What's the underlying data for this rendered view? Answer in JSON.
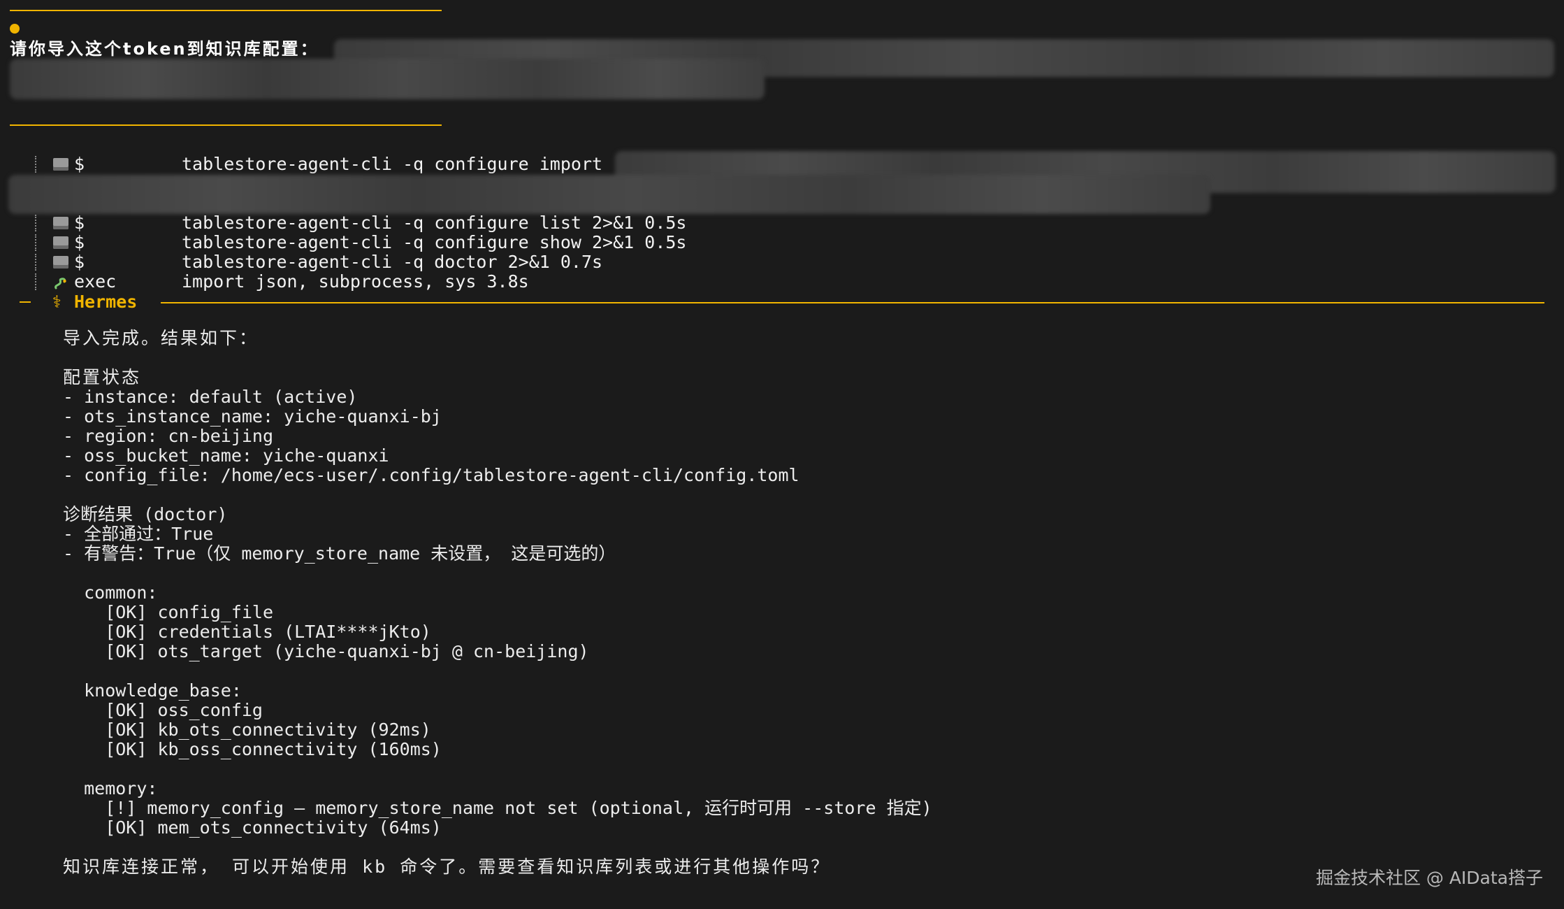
{
  "user_message": {
    "text": "请你导入这个token到知识库配置："
  },
  "tool_calls": [
    {
      "kind": "$",
      "icon": "terminal-icon",
      "command": "tablestore-agent-cli -q configure import",
      "duration": ""
    },
    {
      "kind": "$",
      "icon": "terminal-icon",
      "command": "tablestore-agent-cli -q configure list 2>&1",
      "duration": "0.5s"
    },
    {
      "kind": "$",
      "icon": "terminal-icon",
      "command": "tablestore-agent-cli -q configure show 2>&1",
      "duration": "0.5s"
    },
    {
      "kind": "$",
      "icon": "terminal-icon",
      "command": "tablestore-agent-cli -q doctor 2>&1",
      "duration": "0.7s"
    },
    {
      "kind": "exec",
      "icon": "python-snake-icon",
      "command": "import json, subprocess, sys",
      "duration": "3.8s"
    }
  ],
  "assistant": {
    "name": "Hermes",
    "icon": "caduceus-icon",
    "lines": [
      "导入完成。结果如下：",
      "",
      "配置状态",
      "- instance: default (active)",
      "- ots_instance_name: yiche-quanxi-bj",
      "- region: cn-beijing",
      "- oss_bucket_name: yiche-quanxi",
      "- config_file: /home/ecs-user/.config/tablestore-agent-cli/config.toml",
      "",
      "诊断结果 (doctor)",
      "- 全部通过：True",
      "- 有警告：True（仅 memory_store_name 未设置， 这是可选的）",
      "",
      "  common:",
      "    [OK] config_file",
      "    [OK] credentials (LTAI****jKto)",
      "    [OK] ots_target (yiche-quanxi-bj @ cn-beijing)",
      "",
      "  knowledge_base:",
      "    [OK] oss_config",
      "    [OK] kb_ots_connectivity (92ms)",
      "    [OK] kb_oss_connectivity (160ms)",
      "",
      "  memory:",
      "    [!] memory_config — memory_store_name not set (optional, 运行时可用 --store 指定)",
      "    [OK] mem_ots_connectivity (64ms)",
      "",
      "知识库连接正常， 可以开始使用 kb 命令了。需要查看知识库列表或进行其他操作吗？"
    ]
  },
  "watermark": "掘金技术社区 @ AIData搭子",
  "colors": {
    "background": "#1b1b1b",
    "accent": "#f0b400",
    "text": "#e9e9e9"
  }
}
